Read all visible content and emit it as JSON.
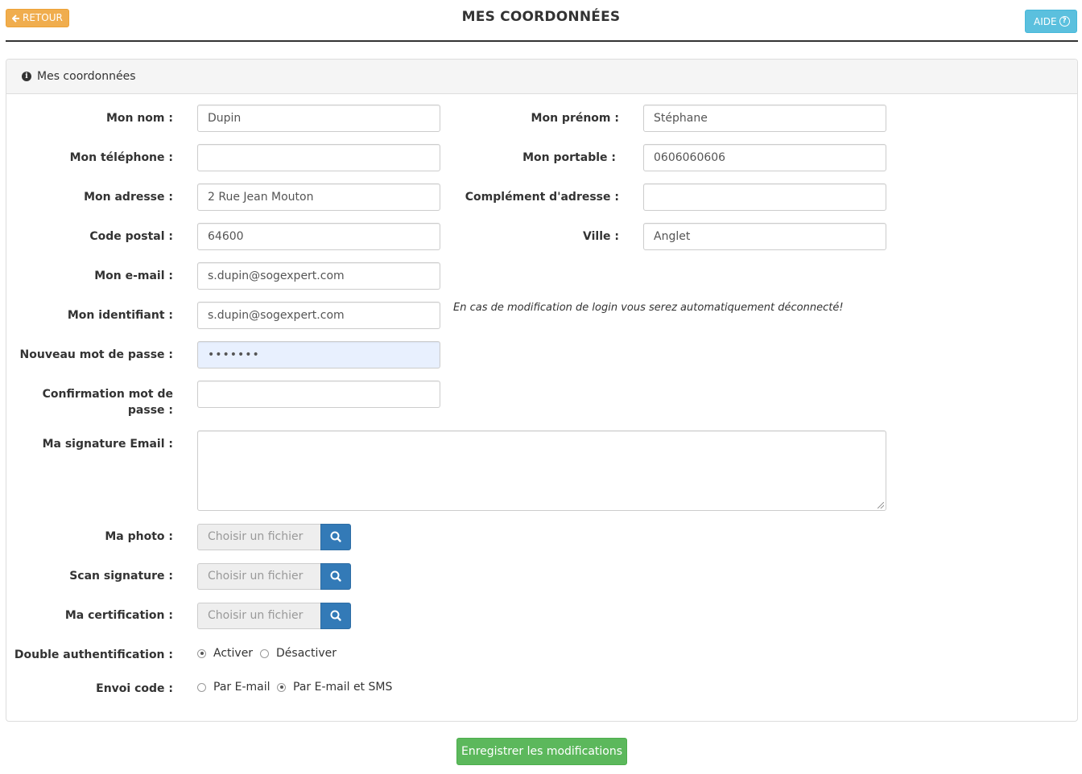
{
  "header": {
    "back_label": "RETOUR",
    "title": "MES COORDONNÉES",
    "help_label": "AIDE"
  },
  "panel": {
    "heading": "Mes coordonnées"
  },
  "form": {
    "nom": {
      "label": "Mon nom :",
      "value": "Dupin"
    },
    "prenom": {
      "label": "Mon prénom :",
      "value": "Stéphane"
    },
    "telephone": {
      "label": "Mon téléphone :",
      "value": ""
    },
    "portable": {
      "label": "Mon portable :",
      "value": "0606060606"
    },
    "adresse": {
      "label": "Mon adresse :",
      "value": "2 Rue Jean Mouton"
    },
    "complement": {
      "label": "Complément d'adresse :",
      "value": ""
    },
    "code_postal": {
      "label": "Code postal :",
      "value": "64600"
    },
    "ville": {
      "label": "Ville :",
      "value": "Anglet"
    },
    "email": {
      "label": "Mon e-mail :",
      "value": "s.dupin@sogexpert.com"
    },
    "identifiant": {
      "label": "Mon identifiant :",
      "value": "s.dupin@sogexpert.com"
    },
    "login_note": "En cas de modification de login vous serez automatiquement déconnecté!",
    "nouveau_mdp": {
      "label": "Nouveau mot de passe :",
      "value": "•••••••"
    },
    "confirmation_mdp": {
      "label": "Confirmation mot de passe :",
      "value": ""
    },
    "signature_email": {
      "label": "Ma signature Email :",
      "value": ""
    },
    "photo": {
      "label": "Ma photo :",
      "placeholder": "Choisir un fichier"
    },
    "scan_signature": {
      "label": "Scan signature :",
      "placeholder": "Choisir un fichier"
    },
    "certification": {
      "label": "Ma certification :",
      "placeholder": "Choisir un fichier"
    },
    "double_auth": {
      "label": "Double authentification :",
      "options": [
        "Activer",
        "Désactiver"
      ],
      "selected": "Activer"
    },
    "envoi_code": {
      "label": "Envoi code :",
      "options": [
        "Par E-mail",
        "Par E-mail et SMS"
      ],
      "selected": "Par E-mail et SMS"
    }
  },
  "footer": {
    "save_label": "Enregistrer les modifications"
  },
  "colors": {
    "back_button": "#f0ad4e",
    "help_button": "#5bc0de",
    "file_button": "#337ab7",
    "save_button": "#5cb85c"
  }
}
